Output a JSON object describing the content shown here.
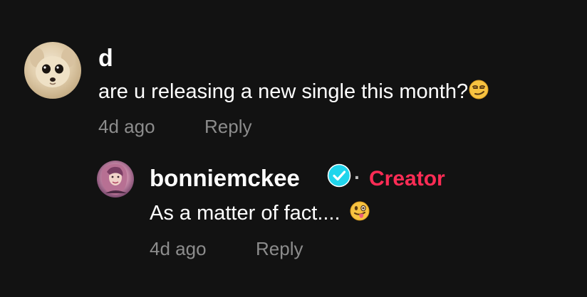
{
  "comment": {
    "username": "d",
    "text": "are u releasing a new single this month?",
    "emoji": "smirking-face",
    "time": "4d ago",
    "reply_label": "Reply"
  },
  "reply": {
    "username": "bonniemckee",
    "verified_icon": "verified-badge-icon",
    "separator": "·",
    "badge": "Creator",
    "text": "As a matter of fact....",
    "emoji": "winking-face-with-tongue",
    "time": "4d ago",
    "reply_label": "Reply"
  },
  "colors": {
    "background": "#121212",
    "creator_badge": "#fe2c55",
    "verified": "#20d5ec",
    "meta_text": "#8c8c8c"
  }
}
